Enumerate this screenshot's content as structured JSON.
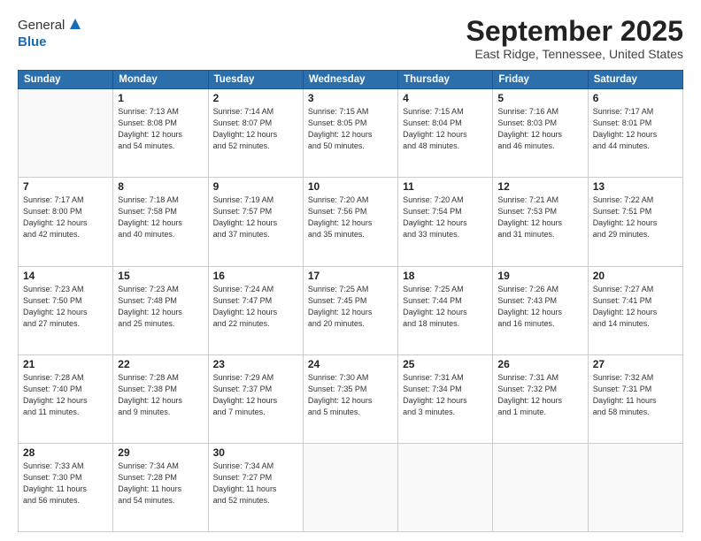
{
  "header": {
    "logo_general": "General",
    "logo_blue": "Blue",
    "month_title": "September 2025",
    "location": "East Ridge, Tennessee, United States"
  },
  "calendar": {
    "days_of_week": [
      "Sunday",
      "Monday",
      "Tuesday",
      "Wednesday",
      "Thursday",
      "Friday",
      "Saturday"
    ],
    "weeks": [
      [
        {
          "day": "",
          "info": ""
        },
        {
          "day": "1",
          "info": "Sunrise: 7:13 AM\nSunset: 8:08 PM\nDaylight: 12 hours\nand 54 minutes."
        },
        {
          "day": "2",
          "info": "Sunrise: 7:14 AM\nSunset: 8:07 PM\nDaylight: 12 hours\nand 52 minutes."
        },
        {
          "day": "3",
          "info": "Sunrise: 7:15 AM\nSunset: 8:05 PM\nDaylight: 12 hours\nand 50 minutes."
        },
        {
          "day": "4",
          "info": "Sunrise: 7:15 AM\nSunset: 8:04 PM\nDaylight: 12 hours\nand 48 minutes."
        },
        {
          "day": "5",
          "info": "Sunrise: 7:16 AM\nSunset: 8:03 PM\nDaylight: 12 hours\nand 46 minutes."
        },
        {
          "day": "6",
          "info": "Sunrise: 7:17 AM\nSunset: 8:01 PM\nDaylight: 12 hours\nand 44 minutes."
        }
      ],
      [
        {
          "day": "7",
          "info": "Sunrise: 7:17 AM\nSunset: 8:00 PM\nDaylight: 12 hours\nand 42 minutes."
        },
        {
          "day": "8",
          "info": "Sunrise: 7:18 AM\nSunset: 7:58 PM\nDaylight: 12 hours\nand 40 minutes."
        },
        {
          "day": "9",
          "info": "Sunrise: 7:19 AM\nSunset: 7:57 PM\nDaylight: 12 hours\nand 37 minutes."
        },
        {
          "day": "10",
          "info": "Sunrise: 7:20 AM\nSunset: 7:56 PM\nDaylight: 12 hours\nand 35 minutes."
        },
        {
          "day": "11",
          "info": "Sunrise: 7:20 AM\nSunset: 7:54 PM\nDaylight: 12 hours\nand 33 minutes."
        },
        {
          "day": "12",
          "info": "Sunrise: 7:21 AM\nSunset: 7:53 PM\nDaylight: 12 hours\nand 31 minutes."
        },
        {
          "day": "13",
          "info": "Sunrise: 7:22 AM\nSunset: 7:51 PM\nDaylight: 12 hours\nand 29 minutes."
        }
      ],
      [
        {
          "day": "14",
          "info": "Sunrise: 7:23 AM\nSunset: 7:50 PM\nDaylight: 12 hours\nand 27 minutes."
        },
        {
          "day": "15",
          "info": "Sunrise: 7:23 AM\nSunset: 7:48 PM\nDaylight: 12 hours\nand 25 minutes."
        },
        {
          "day": "16",
          "info": "Sunrise: 7:24 AM\nSunset: 7:47 PM\nDaylight: 12 hours\nand 22 minutes."
        },
        {
          "day": "17",
          "info": "Sunrise: 7:25 AM\nSunset: 7:45 PM\nDaylight: 12 hours\nand 20 minutes."
        },
        {
          "day": "18",
          "info": "Sunrise: 7:25 AM\nSunset: 7:44 PM\nDaylight: 12 hours\nand 18 minutes."
        },
        {
          "day": "19",
          "info": "Sunrise: 7:26 AM\nSunset: 7:43 PM\nDaylight: 12 hours\nand 16 minutes."
        },
        {
          "day": "20",
          "info": "Sunrise: 7:27 AM\nSunset: 7:41 PM\nDaylight: 12 hours\nand 14 minutes."
        }
      ],
      [
        {
          "day": "21",
          "info": "Sunrise: 7:28 AM\nSunset: 7:40 PM\nDaylight: 12 hours\nand 11 minutes."
        },
        {
          "day": "22",
          "info": "Sunrise: 7:28 AM\nSunset: 7:38 PM\nDaylight: 12 hours\nand 9 minutes."
        },
        {
          "day": "23",
          "info": "Sunrise: 7:29 AM\nSunset: 7:37 PM\nDaylight: 12 hours\nand 7 minutes."
        },
        {
          "day": "24",
          "info": "Sunrise: 7:30 AM\nSunset: 7:35 PM\nDaylight: 12 hours\nand 5 minutes."
        },
        {
          "day": "25",
          "info": "Sunrise: 7:31 AM\nSunset: 7:34 PM\nDaylight: 12 hours\nand 3 minutes."
        },
        {
          "day": "26",
          "info": "Sunrise: 7:31 AM\nSunset: 7:32 PM\nDaylight: 12 hours\nand 1 minute."
        },
        {
          "day": "27",
          "info": "Sunrise: 7:32 AM\nSunset: 7:31 PM\nDaylight: 11 hours\nand 58 minutes."
        }
      ],
      [
        {
          "day": "28",
          "info": "Sunrise: 7:33 AM\nSunset: 7:30 PM\nDaylight: 11 hours\nand 56 minutes."
        },
        {
          "day": "29",
          "info": "Sunrise: 7:34 AM\nSunset: 7:28 PM\nDaylight: 11 hours\nand 54 minutes."
        },
        {
          "day": "30",
          "info": "Sunrise: 7:34 AM\nSunset: 7:27 PM\nDaylight: 11 hours\nand 52 minutes."
        },
        {
          "day": "",
          "info": ""
        },
        {
          "day": "",
          "info": ""
        },
        {
          "day": "",
          "info": ""
        },
        {
          "day": "",
          "info": ""
        }
      ]
    ]
  }
}
